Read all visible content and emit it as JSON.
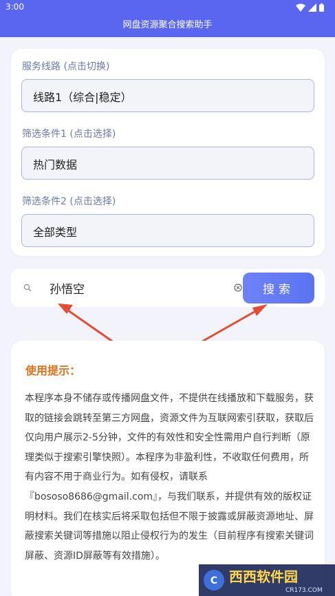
{
  "status_bar": {
    "time": "3:00"
  },
  "app": {
    "title": "网盘资源聚合搜索助手"
  },
  "filters": [
    {
      "label": "服务线路 (点击切换)",
      "value": "线路1（综合|稳定）"
    },
    {
      "label": "筛选条件1 (点击选择)",
      "value": "热门数据"
    },
    {
      "label": "筛选条件2 (点击选择)",
      "value": "全部类型"
    }
  ],
  "search": {
    "value": "孙悟空",
    "button_label": "搜索"
  },
  "tips": {
    "title": "使用提示：",
    "body": "本程序本身不储存或传播网盘文件，不提供在线播放和下载服务，获取的链接会跳转至第三方网盘，资源文件为互联网索引获取，获取后仅向用户展示2-5分钟，文件的有效性和安全性需用户自行判断（原理类似于搜索引擎快照）。本程序为非盈利性，不收取任何费用，所有内容不用于商业行为。如有侵权，请联系『bososo8686@gmail.com』，与我们联系，并提供有效的版权证明材料。我们在核实后将采取包括但不限于披露或屏蔽资源地址、屏蔽搜索关键词等措施以阻止侵权行为的发生（目前程序有搜索关键词屏蔽、资源ID屏蔽等有效措施）。"
  },
  "watermark": {
    "brand": "西西软件园",
    "domain": "CR173.COM"
  },
  "icons": {
    "search": "search-icon",
    "clear": "clear-circle-icon",
    "wifi": "wifi-icon",
    "signal": "signal-icon",
    "battery": "battery-icon",
    "annotation": "red-arrow-icon"
  },
  "colors": {
    "primary": "#5b66f0",
    "button": "#6477f4",
    "tips_title": "#e07018",
    "arrow": "#e54a32"
  }
}
